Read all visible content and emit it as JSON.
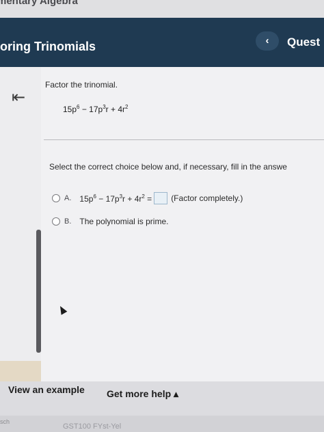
{
  "course": {
    "title": "mentary Algebra"
  },
  "header": {
    "section_title": "oring Trinomials",
    "prev_label": "‹",
    "question_label": "Quest"
  },
  "sidebar": {
    "collapse_icon": "collapse-left-arrow-icon",
    "collapse_glyph": "⇤"
  },
  "problem": {
    "prompt": "Factor the trinomial.",
    "expression": {
      "t1": "15p",
      "e1": "6",
      "op1": " − 17p",
      "e2": "3",
      "t2": "r + 4r",
      "e3": "2"
    }
  },
  "instruction": "Select the correct choice below and, if necessary, fill in the answe",
  "choices": [
    {
      "letter": "A.",
      "expression": {
        "t1": "15p",
        "e1": "6",
        "op1": " − 17p",
        "e2": "3",
        "t2": "r + 4r",
        "e3": "2",
        "eq": " ="
      },
      "note": "(Factor completely.)"
    },
    {
      "letter": "B.",
      "text": "The polynomial is prime."
    }
  ],
  "footer": {
    "view_example": "View an example",
    "more_help": "Get more help ▴"
  },
  "taskbar": {
    "left": "sch",
    "text": "GST100 FYst-Yel"
  },
  "colors": {
    "header_bg": "#1f3a52",
    "panel_bg": "#f1f1f3",
    "answer_box": "#e8f0f6"
  }
}
